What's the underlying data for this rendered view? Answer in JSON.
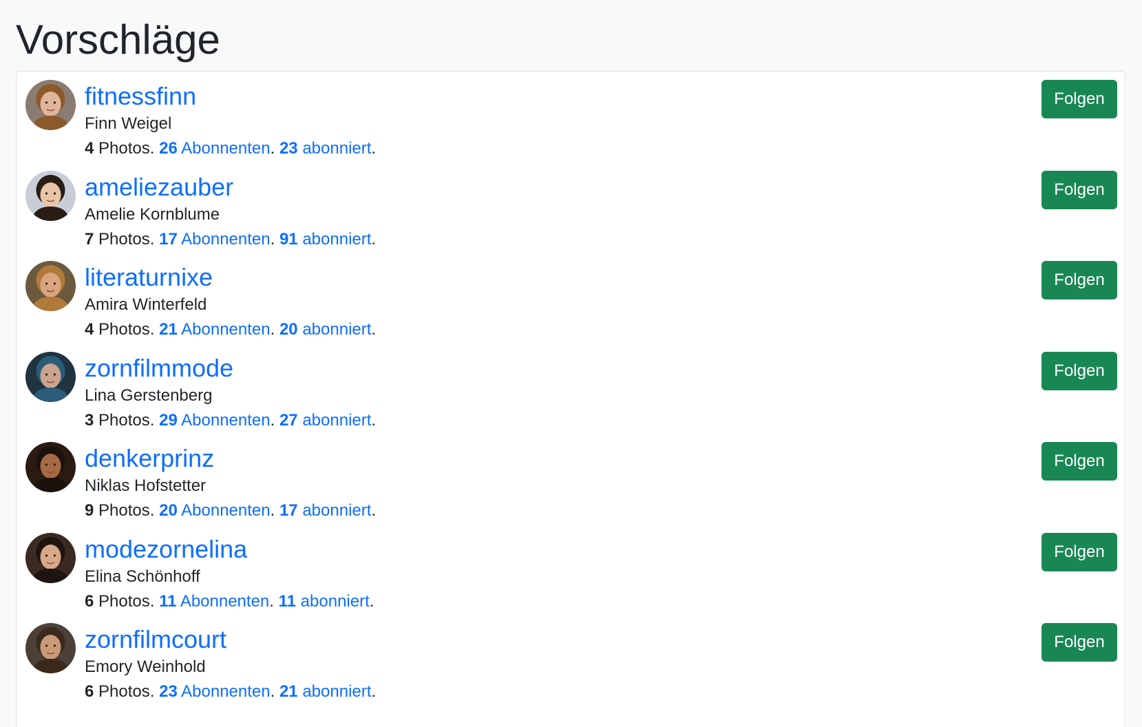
{
  "page": {
    "title": "Vorschläge"
  },
  "labels": {
    "photos": " Photos. ",
    "followers": "Abonnenten",
    "following": "abonniert",
    "dot": ". ",
    "end": "."
  },
  "colors": {
    "link": "#0d6efd",
    "follow_button": "#198754",
    "text": "#212529",
    "page_background": "#f8f9fa"
  },
  "suggestions": [
    {
      "username": "fitnessfinn",
      "full_name": "Finn Weigel",
      "photos": "4",
      "followers": "26",
      "following": "23",
      "follow_label": "Folgen",
      "avatar_icon": "avatar-photo-icon",
      "avatar_bg": "#8a7c70",
      "avatar_skin": "#e0b59a",
      "avatar_hair": "#8b5a2b"
    },
    {
      "username": "ameliezauber",
      "full_name": "Amelie Kornblume",
      "photos": "7",
      "followers": "17",
      "following": "91",
      "follow_label": "Folgen",
      "avatar_icon": "avatar-photo-icon",
      "avatar_bg": "#c9ced6",
      "avatar_skin": "#e8c4a8",
      "avatar_hair": "#2a1d16"
    },
    {
      "username": "literaturnixe",
      "full_name": "Amira Winterfeld",
      "photos": "4",
      "followers": "21",
      "following": "20",
      "follow_label": "Folgen",
      "avatar_icon": "avatar-photo-icon",
      "avatar_bg": "#6b5a3e",
      "avatar_skin": "#d9a57e",
      "avatar_hair": "#b07a3a"
    },
    {
      "username": "zornfilmmode",
      "full_name": "Lina Gerstenberg",
      "photos": "3",
      "followers": "29",
      "following": "27",
      "follow_label": "Folgen",
      "avatar_icon": "avatar-photo-icon",
      "avatar_bg": "#1f3340",
      "avatar_skin": "#c9a48e",
      "avatar_hair": "#2b5c78"
    },
    {
      "username": "denkerprinz",
      "full_name": "Niklas Hofstetter",
      "photos": "9",
      "followers": "20",
      "following": "17",
      "follow_label": "Folgen",
      "avatar_icon": "avatar-photo-icon",
      "avatar_bg": "#2a1a12",
      "avatar_skin": "#a86a44",
      "avatar_hair": "#1a120d"
    },
    {
      "username": "modezornelina",
      "full_name": "Elina Schönhoff",
      "photos": "6",
      "followers": "11",
      "following": "11",
      "follow_label": "Folgen",
      "avatar_icon": "avatar-photo-icon",
      "avatar_bg": "#3a2a22",
      "avatar_skin": "#d8a888",
      "avatar_hair": "#1e1410"
    },
    {
      "username": "zornfilmcourt",
      "full_name": "Emory Weinhold",
      "photos": "6",
      "followers": "23",
      "following": "21",
      "follow_label": "Folgen",
      "avatar_icon": "avatar-photo-icon",
      "avatar_bg": "#4a4038",
      "avatar_skin": "#c99a78",
      "avatar_hair": "#3b2a1c"
    }
  ]
}
